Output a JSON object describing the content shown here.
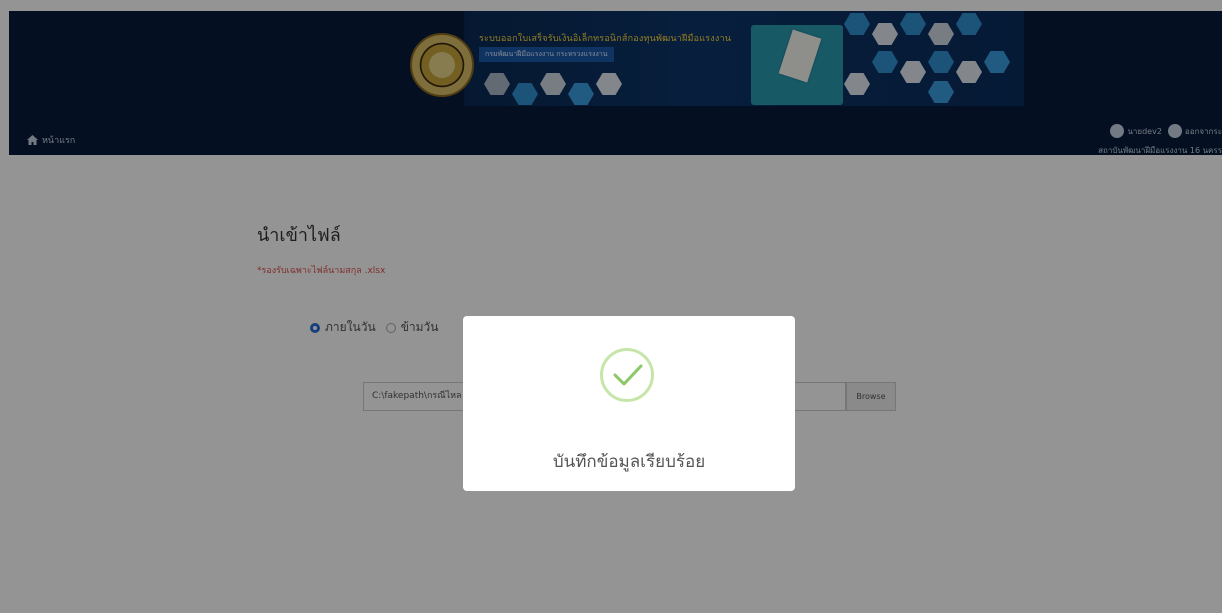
{
  "header": {
    "banner_title": "ระบบออกใบเสร็จรับเงินอิเล็กทรอนิกส์กองทุนพัฒนาฝีมือแรงงาน",
    "banner_subtitle": "กรมพัฒนาฝีมือแรงงาน กระทรวงแรงงาน",
    "home_label": "หน้าแรก",
    "user_label": "นายdev2",
    "logout_label": "ออกจากระ",
    "org_label": "สถาบันพัฒนาฝีมือแรงงาน 16 นครร"
  },
  "main": {
    "page_title": "นำเข้าไฟล์",
    "note": "*รองรับเฉพาะไฟล์นามสกุล .xlsx",
    "radio_inside_label": "ภายในวัน",
    "radio_across_label": "ข้ามวัน",
    "file_path_value": "C:\\fakepath\\กรณีไหล",
    "browse_label": "Browse"
  },
  "modal": {
    "message": "บันทึกข้อมูลเรียบร้อย"
  },
  "colors": {
    "header_bg": "#071d3b",
    "accent_blue": "#2a6fd6",
    "note_red": "#d9534f",
    "check_green": "#8cc866"
  }
}
